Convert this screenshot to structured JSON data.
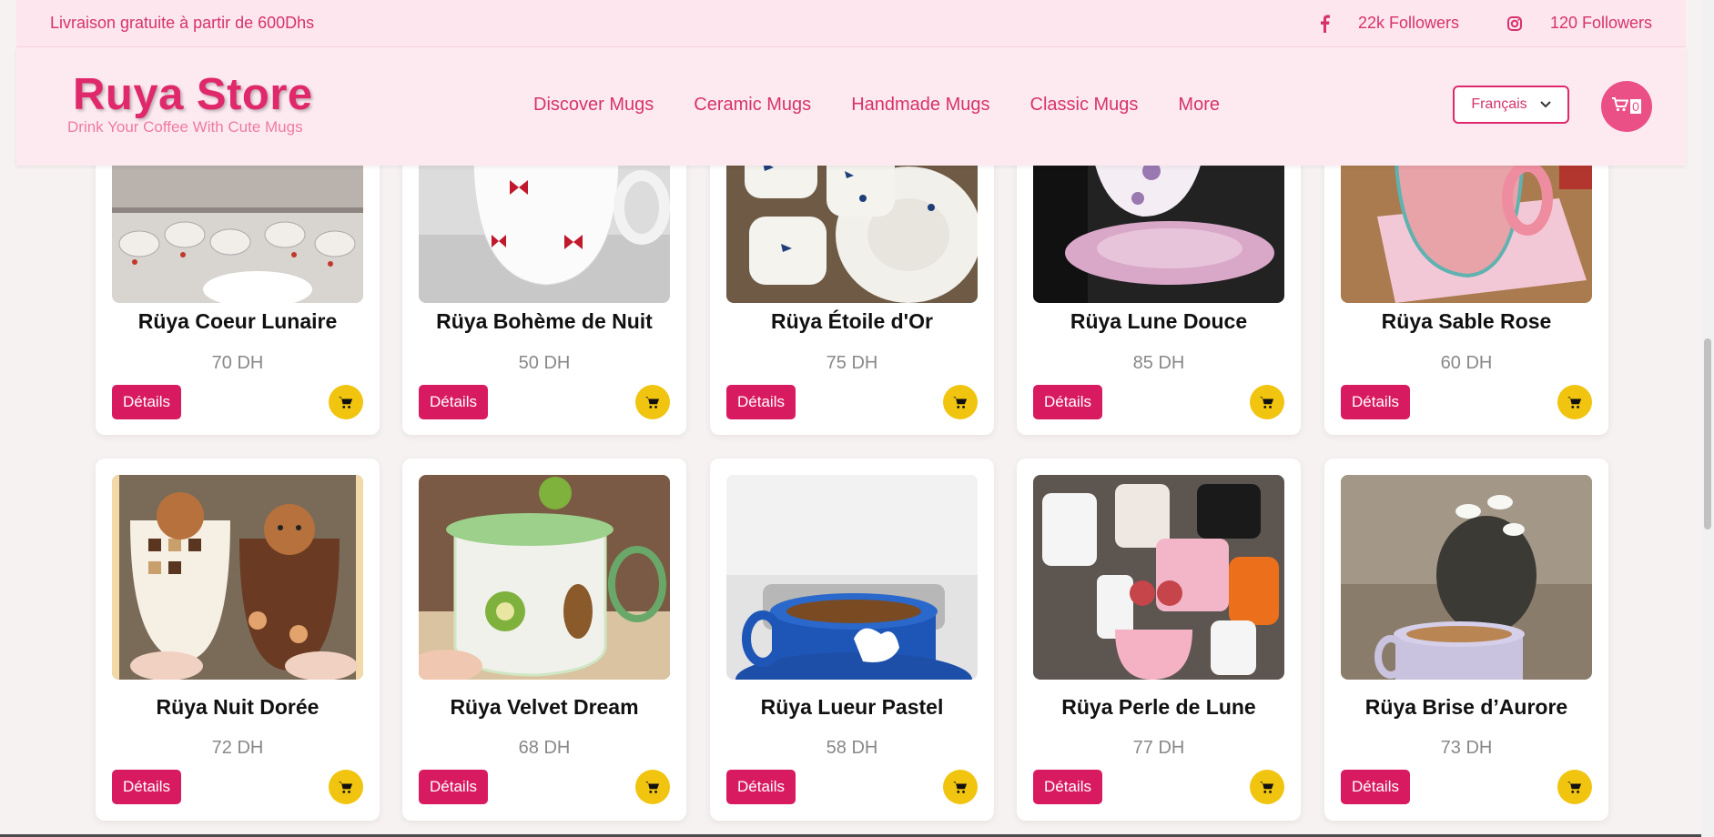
{
  "topbar": {
    "promo": "Livraison gratuite à partir de 600Dhs",
    "facebook_count": "22k Followers",
    "instagram_count": "120 Followers"
  },
  "header": {
    "brand_name": "Ruya Store",
    "tagline": "Drink Your Coffee With Cute Mugs",
    "nav": [
      "Discover Mugs",
      "Ceramic Mugs",
      "Handmade Mugs",
      "Classic Mugs",
      "More"
    ],
    "language": "Français",
    "cart_count": "0"
  },
  "colors": {
    "accent": "#d81b60",
    "brand": "#e0296b",
    "cart_button": "#f1c40f",
    "topbar_bg": "#fde6ee"
  },
  "buttons": {
    "details_label": "Détails"
  },
  "products": [
    {
      "name": "Rüya Coeur Lunaire",
      "price": "70 DH"
    },
    {
      "name": "Rüya Bohème de Nuit",
      "price": "50 DH"
    },
    {
      "name": "Rüya Étoile d'Or",
      "price": "75 DH"
    },
    {
      "name": "Rüya Lune Douce",
      "price": "85 DH"
    },
    {
      "name": "Rüya Sable Rose",
      "price": "60 DH"
    },
    {
      "name": "Rüya Nuit Dorée",
      "price": "72 DH"
    },
    {
      "name": "Rüya Velvet Dream",
      "price": "68 DH"
    },
    {
      "name": "Rüya Lueur Pastel",
      "price": "58 DH"
    },
    {
      "name": "Rüya Perle de Lune",
      "price": "77 DH"
    },
    {
      "name": "Rüya Brise d’Aurore",
      "price": "73 DH"
    }
  ]
}
